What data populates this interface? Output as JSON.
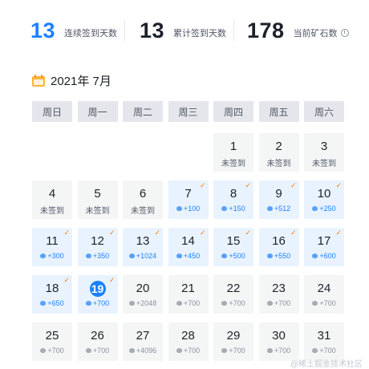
{
  "stats": {
    "continuous": {
      "value": "13",
      "label": "连续签到天数"
    },
    "total": {
      "value": "13",
      "label": "累计签到天数"
    },
    "ore": {
      "value": "178",
      "label": "当前矿石数"
    }
  },
  "calendar": {
    "title": "2021年 7月",
    "weekdays": [
      "周日",
      "周一",
      "周二",
      "周三",
      "周四",
      "周五",
      "周六"
    ],
    "unsigned_label": "未签到",
    "days": [
      {
        "day": "1",
        "status": "unsigned"
      },
      {
        "day": "2",
        "status": "unsigned"
      },
      {
        "day": "3",
        "status": "unsigned"
      },
      {
        "day": "4",
        "status": "unsigned"
      },
      {
        "day": "5",
        "status": "unsigned"
      },
      {
        "day": "6",
        "status": "unsigned"
      },
      {
        "day": "7",
        "status": "signed",
        "reward": "+100"
      },
      {
        "day": "8",
        "status": "signed",
        "reward": "+150"
      },
      {
        "day": "9",
        "status": "signed",
        "reward": "+512"
      },
      {
        "day": "10",
        "status": "signed",
        "reward": "+250"
      },
      {
        "day": "11",
        "status": "signed",
        "reward": "+300"
      },
      {
        "day": "12",
        "status": "signed",
        "reward": "+350"
      },
      {
        "day": "13",
        "status": "signed",
        "reward": "+1024"
      },
      {
        "day": "14",
        "status": "signed",
        "reward": "+450"
      },
      {
        "day": "15",
        "status": "signed",
        "reward": "+500"
      },
      {
        "day": "16",
        "status": "signed",
        "reward": "+550"
      },
      {
        "day": "17",
        "status": "signed",
        "reward": "+600"
      },
      {
        "day": "18",
        "status": "signed",
        "reward": "+650"
      },
      {
        "day": "19",
        "status": "today",
        "reward": "+700"
      },
      {
        "day": "20",
        "status": "future",
        "reward": "+2048"
      },
      {
        "day": "21",
        "status": "future",
        "reward": "+700"
      },
      {
        "day": "22",
        "status": "future",
        "reward": "+700"
      },
      {
        "day": "23",
        "status": "future",
        "reward": "+700"
      },
      {
        "day": "24",
        "status": "future",
        "reward": "+700"
      },
      {
        "day": "25",
        "status": "future",
        "reward": "+700"
      },
      {
        "day": "26",
        "status": "future",
        "reward": "+700"
      },
      {
        "day": "27",
        "status": "future",
        "reward": "+4096"
      },
      {
        "day": "28",
        "status": "future",
        "reward": "+700"
      },
      {
        "day": "29",
        "status": "future",
        "reward": "+700"
      },
      {
        "day": "30",
        "status": "future",
        "reward": "+700"
      },
      {
        "day": "31",
        "status": "future",
        "reward": "+700"
      }
    ]
  },
  "colors": {
    "accent": "#1e80ff",
    "check": "#ff7d00",
    "signed_bg": "#e8f3ff"
  },
  "watermark": "@稀土掘金技术社区"
}
